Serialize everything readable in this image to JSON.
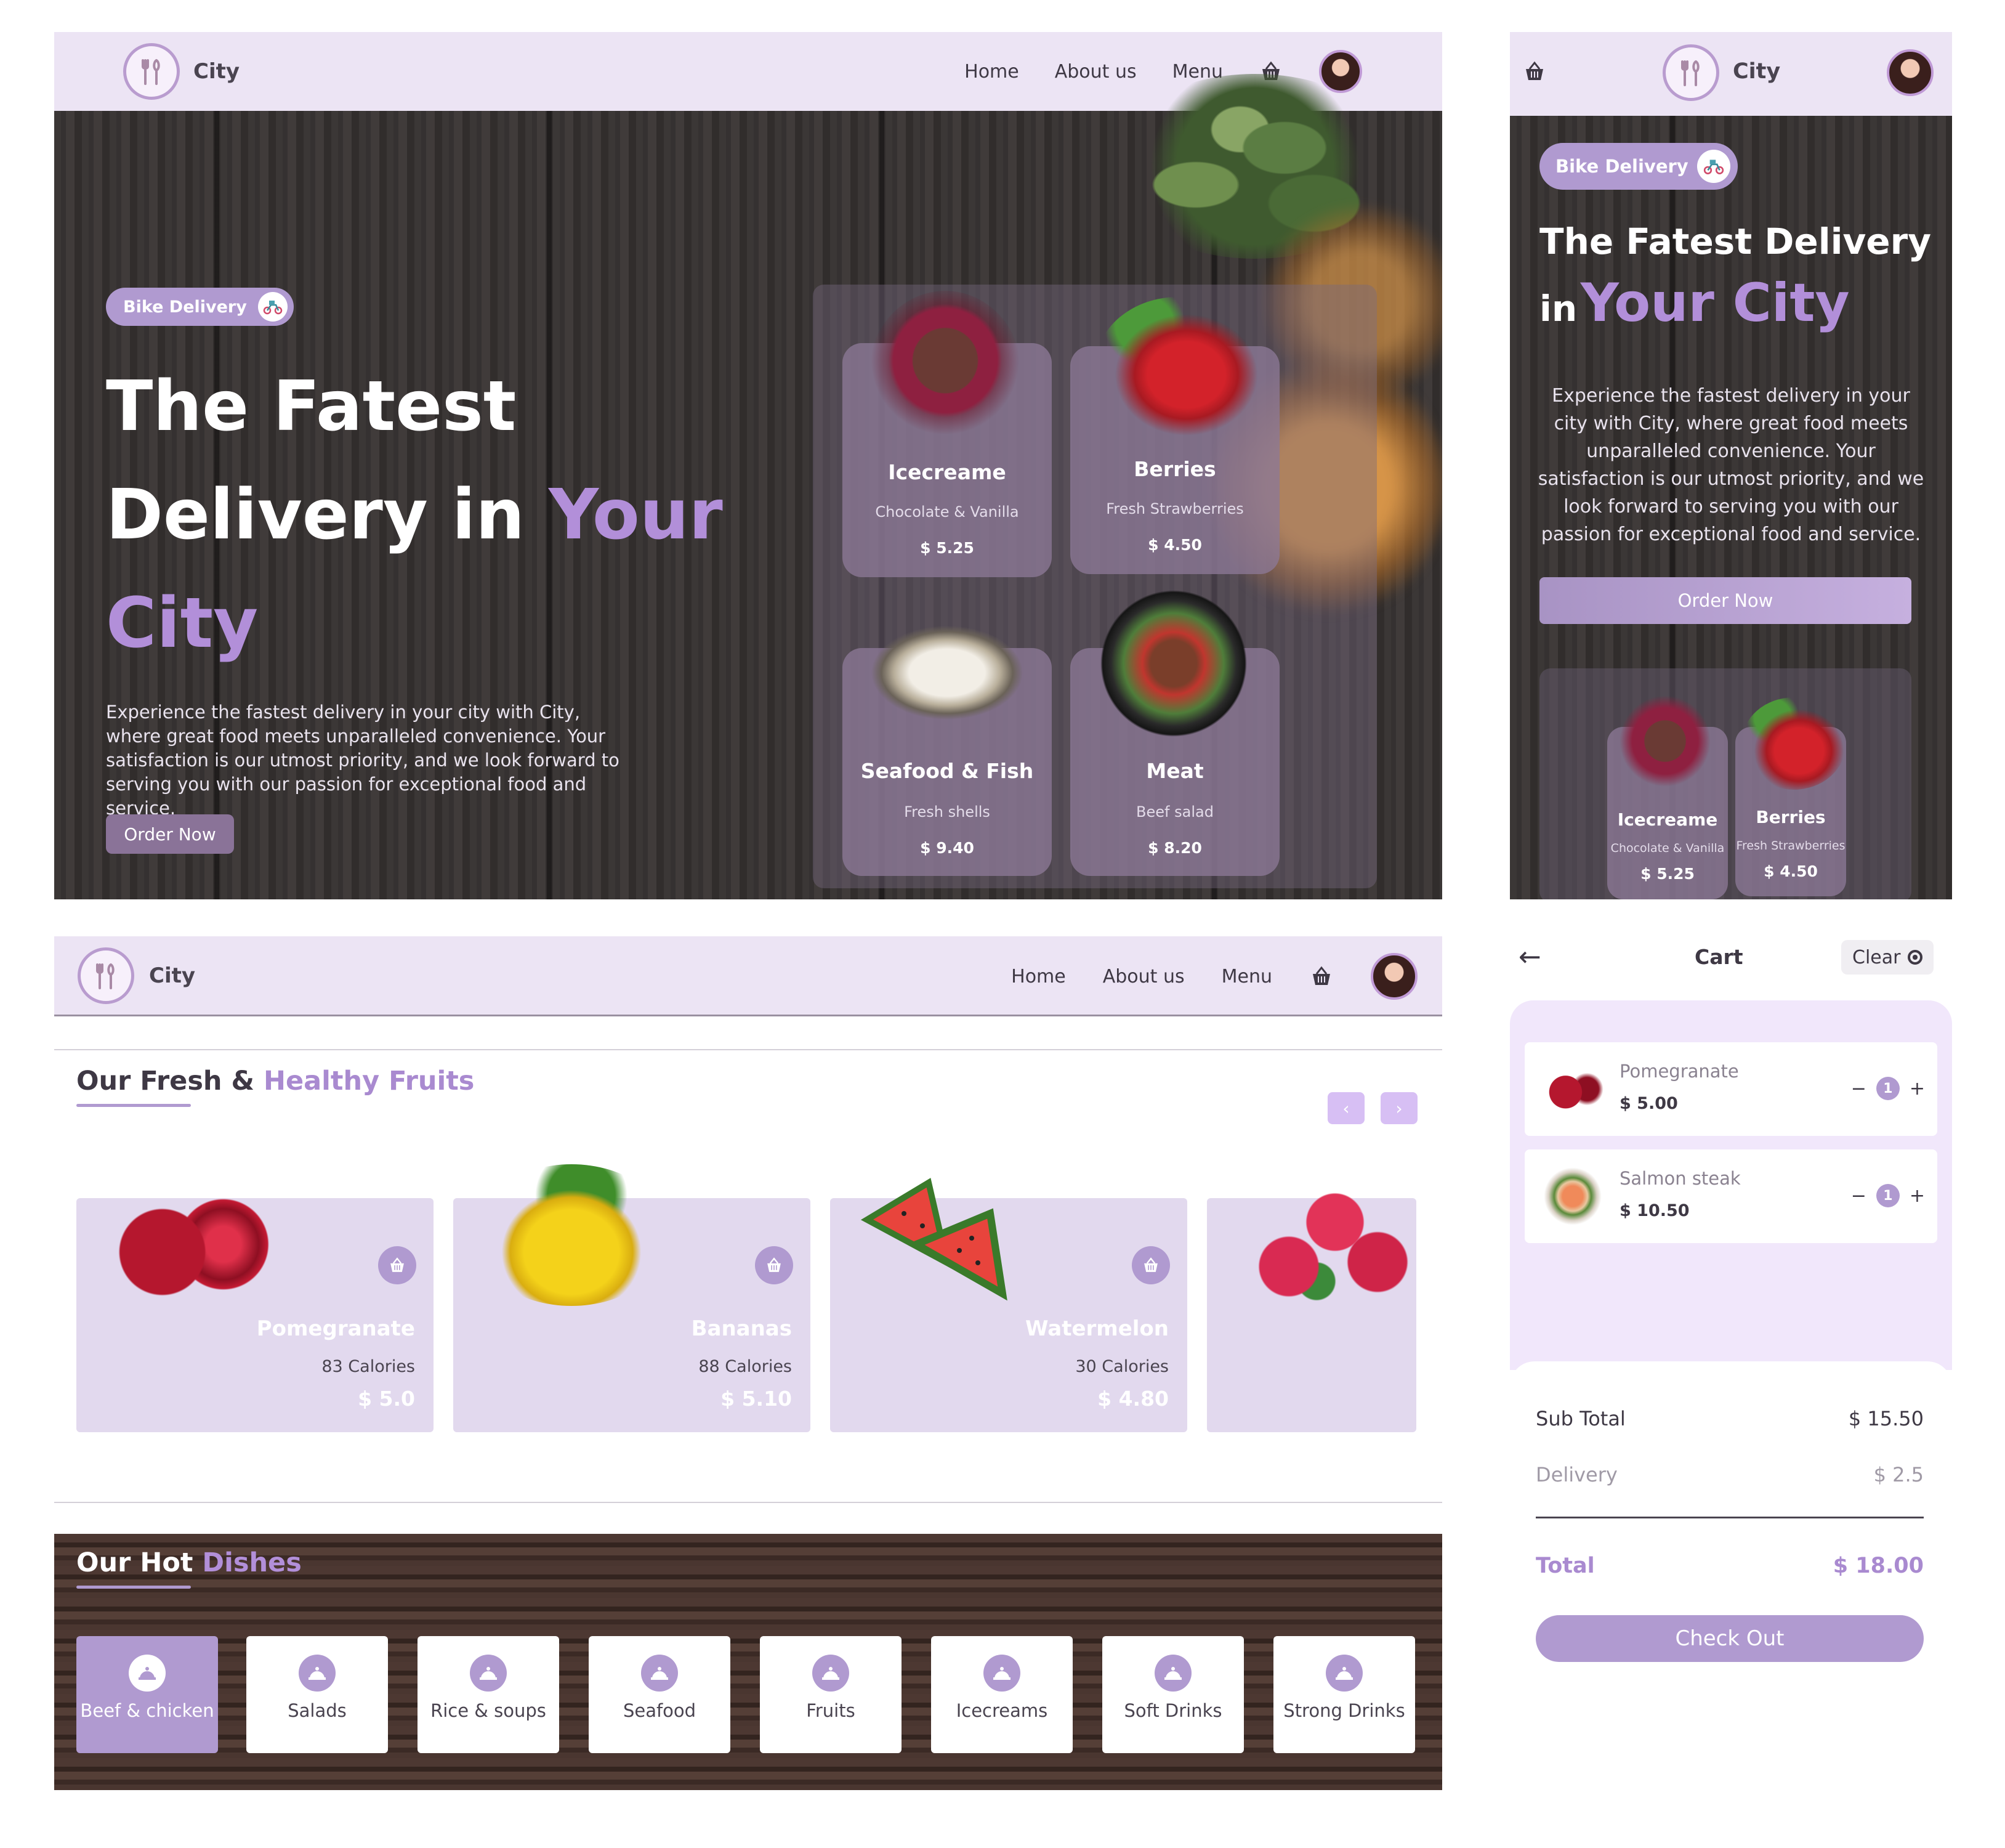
{
  "brand": "City",
  "nav": {
    "home": "Home",
    "about": "About us",
    "menu": "Menu"
  },
  "icons": {
    "logo": "fork-spoon-icon",
    "basket": "basket-icon",
    "bike": "bike-icon",
    "dish": "cloche-icon"
  },
  "colors": {
    "accent": "#b28fd9",
    "nav_bg": "#ece4f4",
    "card": "#e2d9ee",
    "button": "#b09ad0"
  },
  "hero": {
    "badge": "Bike Delivery",
    "title_line1": "The Fatest",
    "title_line2a": "Delivery in",
    "title_line2b": "Your",
    "title_line3": "City",
    "description": "Experience the fastest delivery in your city with City, where great food meets unparalleled convenience. Your satisfaction is our utmost priority, and we look forward to serving you with our passion for exceptional food and service.",
    "cta": "Order Now",
    "cards": [
      {
        "name": "Icecreame",
        "sub": "Chocolate & Vanilla",
        "price": "$ 5.25"
      },
      {
        "name": "Berries",
        "sub": "Fresh Strawberries",
        "price": "$ 4.50"
      },
      {
        "name": "Seafood & Fish",
        "sub": "Fresh shells",
        "price": "$ 9.40"
      },
      {
        "name": "Meat",
        "sub": "Beef salad",
        "price": "$ 8.20"
      }
    ]
  },
  "mobile_hero": {
    "title_line1": "The Fatest Delivery",
    "title_in": "in",
    "title_accent": "Your City"
  },
  "fruits": {
    "title_a": "Our Fresh &",
    "title_b": "Healthy Fruits",
    "prev": "‹",
    "next": "›",
    "items": [
      {
        "name": "Pomegranate",
        "calories": "83 Calories",
        "price": "$ 5.0"
      },
      {
        "name": "Bananas",
        "calories": "88 Calories",
        "price": "$ 5.10"
      },
      {
        "name": "Watermelon",
        "calories": "30 Calories",
        "price": "$ 4.80"
      }
    ]
  },
  "dishes": {
    "title_a": "Our Hot",
    "title_b": "Dishes",
    "items": [
      "Beef & chicken",
      "Salads",
      "Rice & soups",
      "Seafood",
      "Fruits",
      "Icecreams",
      "Soft Drinks",
      "Strong Drinks"
    ],
    "active": "Beef & chicken"
  },
  "cart": {
    "back": "←",
    "title": "Cart",
    "clear": "Clear",
    "items": [
      {
        "name": "Pomegranate",
        "price": "$ 5.00",
        "qty": "1",
        "minus": "−",
        "plus": "+"
      },
      {
        "name": "Salmon steak",
        "price": "$ 10.50",
        "qty": "1",
        "minus": "−",
        "plus": "+"
      }
    ],
    "subtotal_label": "Sub Total",
    "subtotal": "$ 15.50",
    "delivery_label": "Delivery",
    "delivery": "$ 2.5",
    "total_label": "Total",
    "total": "$ 18.00",
    "checkout": "Check Out"
  }
}
